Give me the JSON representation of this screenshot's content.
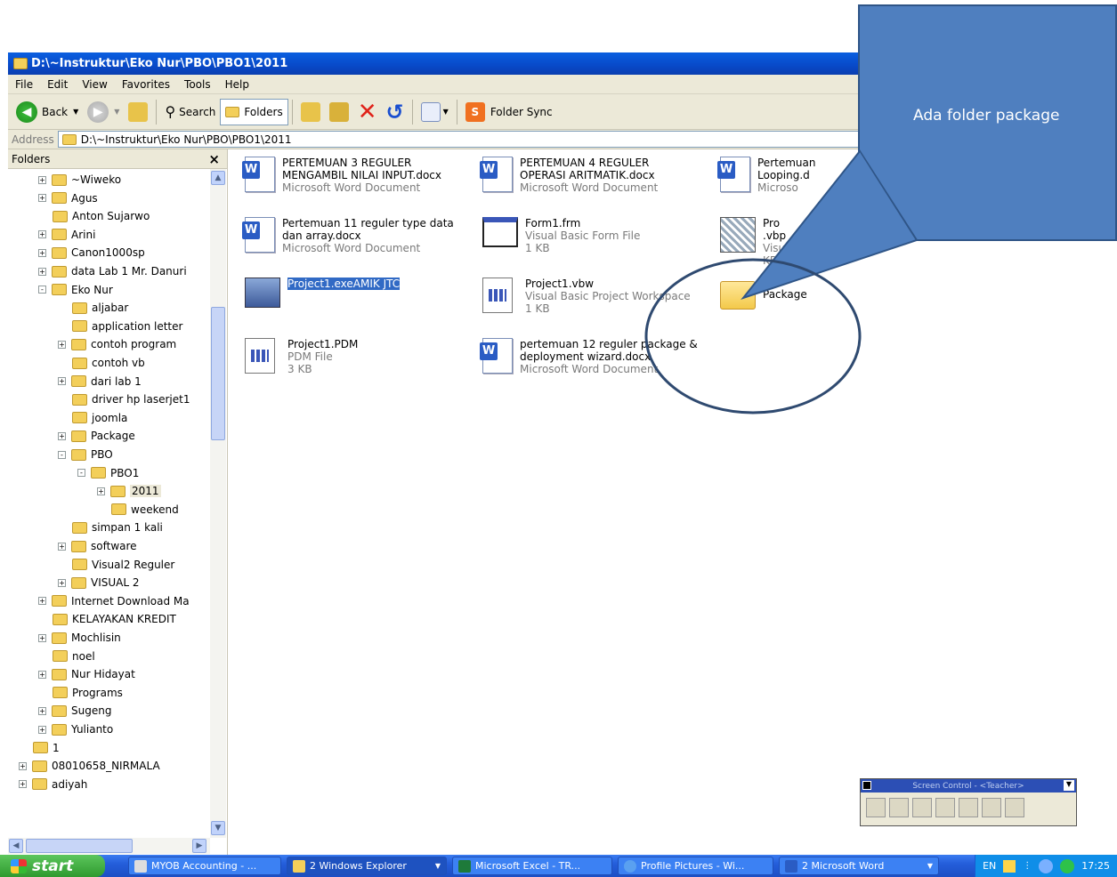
{
  "window": {
    "title": "D:\\~Instruktur\\Eko Nur\\PBO\\PBO1\\2011"
  },
  "menu": [
    "File",
    "Edit",
    "View",
    "Favorites",
    "Tools",
    "Help"
  ],
  "toolbar": {
    "back": "Back",
    "search": "Search",
    "folders": "Folders",
    "folder_sync": "Folder Sync"
  },
  "address": {
    "label": "Address",
    "value": "D:\\~Instruktur\\Eko Nur\\PBO\\PBO1\\2011"
  },
  "pane": {
    "title": "Folders",
    "close": "×"
  },
  "tree": [
    {
      "label": "~Wiweko",
      "indent": 1,
      "exp": "+"
    },
    {
      "label": "Agus",
      "indent": 1,
      "exp": "+"
    },
    {
      "label": "Anton Sujarwo",
      "indent": 1,
      "exp": ""
    },
    {
      "label": "Arini",
      "indent": 1,
      "exp": "+"
    },
    {
      "label": "Canon1000sp",
      "indent": 1,
      "exp": "+"
    },
    {
      "label": "data Lab 1 Mr. Danuri",
      "indent": 1,
      "exp": "+"
    },
    {
      "label": "Eko Nur",
      "indent": 1,
      "exp": "-"
    },
    {
      "label": "aljabar",
      "indent": 2,
      "exp": ""
    },
    {
      "label": "application letter",
      "indent": 2,
      "exp": ""
    },
    {
      "label": "contoh program",
      "indent": 2,
      "exp": "+"
    },
    {
      "label": "contoh vb",
      "indent": 2,
      "exp": ""
    },
    {
      "label": "dari lab 1",
      "indent": 2,
      "exp": "+"
    },
    {
      "label": "driver hp laserjet1",
      "indent": 2,
      "exp": ""
    },
    {
      "label": "joomla",
      "indent": 2,
      "exp": ""
    },
    {
      "label": "Package",
      "indent": 2,
      "exp": "+"
    },
    {
      "label": "PBO",
      "indent": 2,
      "exp": "-"
    },
    {
      "label": "PBO1",
      "indent": 3,
      "exp": "-"
    },
    {
      "label": "2011",
      "indent": 4,
      "exp": "+"
    },
    {
      "label": "weekend",
      "indent": 4,
      "exp": ""
    },
    {
      "label": "simpan 1 kali",
      "indent": 2,
      "exp": ""
    },
    {
      "label": "software",
      "indent": 2,
      "exp": "+"
    },
    {
      "label": "Visual2 Reguler",
      "indent": 2,
      "exp": ""
    },
    {
      "label": "VISUAL 2",
      "indent": 2,
      "exp": "+"
    },
    {
      "label": "Internet Download Ma",
      "indent": 1,
      "exp": "+"
    },
    {
      "label": "KELAYAKAN KREDIT",
      "indent": 1,
      "exp": ""
    },
    {
      "label": "Mochlisin",
      "indent": 1,
      "exp": "+"
    },
    {
      "label": "noel",
      "indent": 1,
      "exp": ""
    },
    {
      "label": "Nur Hidayat",
      "indent": 1,
      "exp": "+"
    },
    {
      "label": "Programs",
      "indent": 1,
      "exp": ""
    },
    {
      "label": "Sugeng",
      "indent": 1,
      "exp": "+"
    },
    {
      "label": "Yulianto",
      "indent": 1,
      "exp": "+"
    },
    {
      "label": "1",
      "indent": 0,
      "exp": ""
    },
    {
      "label": "08010658_NIRMALA",
      "indent": 0,
      "exp": "+"
    },
    {
      "label": "adiyah",
      "indent": 0,
      "exp": "+"
    }
  ],
  "files": [
    {
      "name": "PERTEMUAN 3 REGULER MENGAMBIL NILAI INPUT.docx",
      "line1": "PERTEMUAN 3 REGULER",
      "line2": "MENGAMBIL NILAI INPUT.docx",
      "type": "Microsoft Word Document",
      "size": "",
      "icon": "word-doc-icon"
    },
    {
      "name": "PERTEMUAN 4 REGULER OPERASI ARITMATIK.docx",
      "line1": "PERTEMUAN 4 REGULER",
      "line2": "OPERASI ARITMATIK.docx",
      "type": "Microsoft Word Document",
      "size": "",
      "icon": "word-doc-icon"
    },
    {
      "name": "Pertemuan Looping",
      "line1": "Pertemuan",
      "line2": "Looping.d",
      "type": "Microso",
      "size": "",
      "icon": "word-doc-icon"
    },
    {
      "name": "Pertemuan 11 reguler type data dan array.docx",
      "line1": "Pertemuan 11 reguler  type data",
      "line2": "dan array.docx",
      "type": "Microsoft Word Document",
      "size": "",
      "icon": "word-doc-icon"
    },
    {
      "name": "Form1.frm",
      "line1": "Form1.frm",
      "line2": "",
      "type": "Visual Basic Form File",
      "size": "1 KB",
      "icon": "vb-form-icon"
    },
    {
      "name": "Project1.vbp",
      "line1": "Pro",
      "line2": ".vbp",
      "type": "Visual Basic Project",
      "size": "KB",
      "icon": "vb-project-icon"
    },
    {
      "name": "Project1.exe",
      "line1": "Project1.exe",
      "line2": "AMIK JTC",
      "type": "",
      "size": "",
      "icon": "exe-icon"
    },
    {
      "name": "Project1.vbw",
      "line1": "Project1.vbw",
      "line2": "",
      "type": "Visual Basic Project Workspace",
      "size": "1 KB",
      "icon": "vbw-icon"
    },
    {
      "name": "Package",
      "line1": "Package",
      "line2": "",
      "type": "",
      "size": "",
      "icon": "folder-icon"
    },
    {
      "name": "Project1.PDM",
      "line1": "Project1.PDM",
      "line2": "",
      "type": "PDM File",
      "size": "3 KB",
      "icon": "pdm-icon"
    },
    {
      "name": "pertemuan 12 reguler package & deployment wizard.docx",
      "line1": "pertemuan 12 reguler package &",
      "line2": "deployment wizard.docx",
      "type": "Microsoft Word Document",
      "size": "",
      "icon": "word-doc-icon"
    }
  ],
  "callout": {
    "text": "Ada folder package"
  },
  "screen_control": {
    "title": "Screen Control - <Teacher>"
  },
  "taskbar": {
    "start": "start",
    "buttons": [
      "MYOB Accounting - ...",
      "2 Windows Explorer",
      "Microsoft Excel - TR...",
      "Profile Pictures - Wi...",
      "2 Microsoft Word"
    ],
    "tray_lang": "EN",
    "clock": "17:25"
  }
}
